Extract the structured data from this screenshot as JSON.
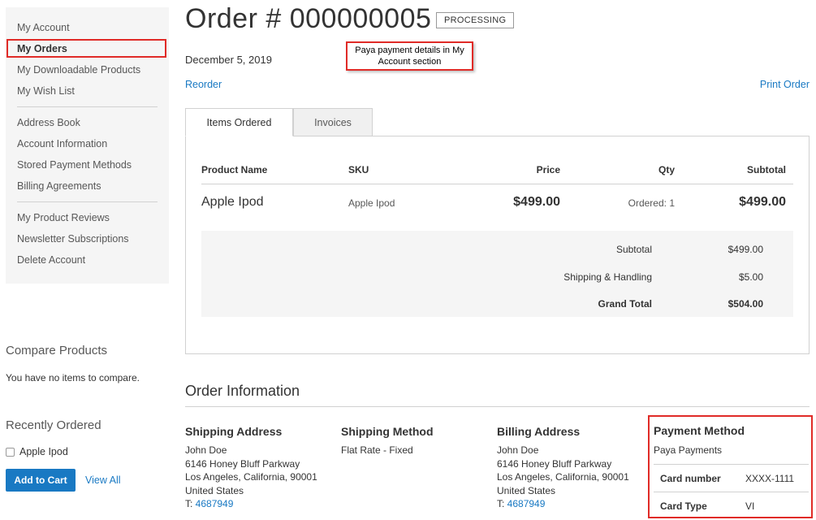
{
  "sidebar": {
    "group1": [
      "My Account",
      "My Orders",
      "My Downloadable Products",
      "My Wish List"
    ],
    "group2": [
      "Address Book",
      "Account Information",
      "Stored Payment Methods",
      "Billing Agreements"
    ],
    "group3": [
      "My Product Reviews",
      "Newsletter Subscriptions",
      "Delete Account"
    ]
  },
  "compare": {
    "title": "Compare Products",
    "empty": "You have no items to compare."
  },
  "recent": {
    "title": "Recently Ordered",
    "item": "Apple Ipod",
    "add_to_cart": "Add to Cart",
    "view_all": "View All"
  },
  "order": {
    "title": "Order # 000000005",
    "status": "PROCESSING",
    "date": "December 5, 2019",
    "reorder": "Reorder",
    "print": "Print Order",
    "callout": "Paya payment details in My Account section"
  },
  "tabs": [
    "Items Ordered",
    "Invoices"
  ],
  "table": {
    "headers": [
      "Product Name",
      "SKU",
      "Price",
      "Qty",
      "Subtotal"
    ],
    "row": {
      "name": "Apple Ipod",
      "sku": "Apple Ipod",
      "price": "$499.00",
      "qty": "Ordered: 1",
      "subtotal": "$499.00"
    }
  },
  "totals": [
    {
      "label": "Subtotal",
      "value": "$499.00"
    },
    {
      "label": "Shipping & Handling",
      "value": "$5.00"
    },
    {
      "label": "Grand Total",
      "value": "$504.00"
    }
  ],
  "info": {
    "title": "Order Information",
    "shipping_address": {
      "heading": "Shipping Address",
      "lines": [
        "John Doe",
        "6146 Honey Bluff Parkway",
        "Los Angeles, California, 90001",
        "United States"
      ],
      "phone_prefix": "T: ",
      "phone": "4687949"
    },
    "shipping_method": {
      "heading": "Shipping Method",
      "value": "Flat Rate - Fixed"
    },
    "billing_address": {
      "heading": "Billing Address",
      "lines": [
        "John Doe",
        "6146 Honey Bluff Parkway",
        "Los Angeles, California, 90001",
        "United States"
      ],
      "phone_prefix": "T: ",
      "phone": "4687949"
    },
    "payment": {
      "heading": "Payment Method",
      "name": "Paya Payments",
      "card_number_label": "Card number",
      "card_number": "XXXX-1111",
      "card_type_label": "Card Type",
      "card_type": "VI"
    }
  },
  "colors": {
    "link": "#1979c3",
    "primary_button": "#1979c3",
    "highlight": "#e02b27",
    "sidebar_bg": "#f5f5f5"
  }
}
